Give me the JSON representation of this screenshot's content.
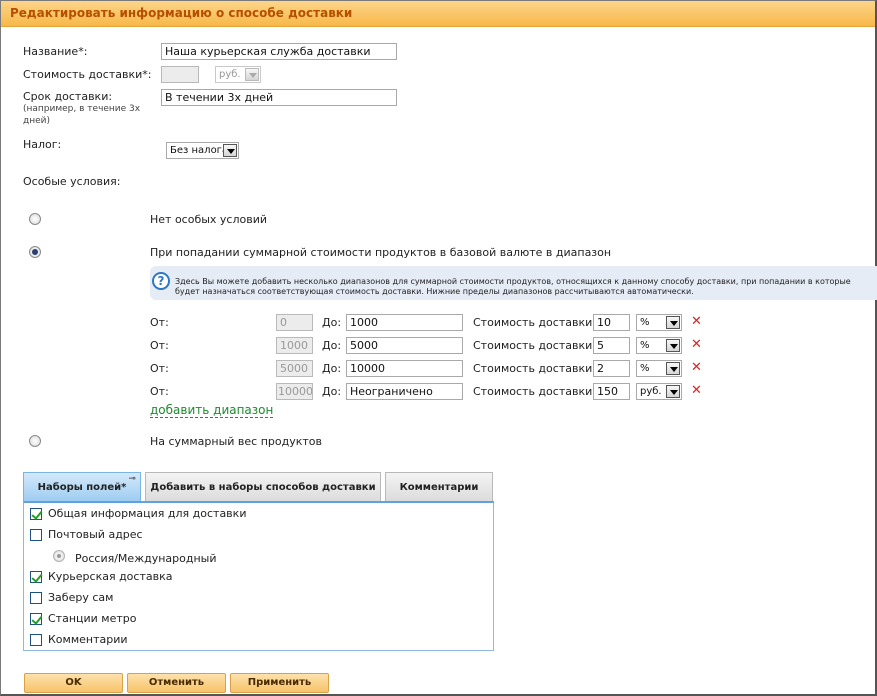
{
  "title": "Редактировать информацию о способе доставки",
  "form": {
    "name_label": "Название*:",
    "name_value": "Наша курьерская служба доставки",
    "cost_label": "Стоимость доставки*:",
    "cost_value": "",
    "cost_currency": "руб.",
    "term_label": "Срок доставки:",
    "term_hint": "(например, в течение 3х дней)",
    "term_value": "В течении 3х дней",
    "tax_label": "Налог:",
    "tax_value": "Без налога",
    "special_label": "Особые условия:"
  },
  "conditions": {
    "none_label": "Нет особых условий",
    "range_label": "При попадании суммарной стоимости продуктов в базовой валюте в диапазон",
    "info_text": "Здесь Вы можете добавить несколько диапазонов для суммарной стоимости продуктов, относящихся к данному способу доставки, при попадании в которые будет назначаться соответствующая стоимость доставки. Нижние пределы диапазонов рассчитываются автоматически.",
    "weight_label": "На суммарный вес продуктов",
    "add_range_label": "добавить диапазон",
    "ranges": [
      {
        "from_label": "От:",
        "from": "0",
        "to_label": "До:",
        "to": "1000",
        "cost_label": "Стоимость доставки:",
        "cost": "10",
        "unit": "%"
      },
      {
        "from_label": "От:",
        "from": "1000",
        "to_label": "До:",
        "to": "5000",
        "cost_label": "Стоимость доставки:",
        "cost": "5",
        "unit": "%"
      },
      {
        "from_label": "От:",
        "from": "5000",
        "to_label": "До:",
        "to": "10000",
        "cost_label": "Стоимость доставки:",
        "cost": "2",
        "unit": "%"
      },
      {
        "from_label": "От:",
        "from": "10000",
        "to_label": "До:",
        "to": "Неограничено",
        "cost_label": "Стоимость доставки:",
        "cost": "150",
        "unit": "руб."
      }
    ],
    "delete_glyph": "✕"
  },
  "tabs": [
    {
      "label": "Наборы полей*"
    },
    {
      "label": "Добавить в наборы способов доставки"
    },
    {
      "label": "Комментарии"
    }
  ],
  "fields": [
    {
      "label": "Общая информация для доставки",
      "checked": true
    },
    {
      "label": "Почтовый адрес",
      "checked": false
    },
    {
      "label": "Россия/Международный"
    },
    {
      "label": "Курьерская доставка",
      "checked": true
    },
    {
      "label": "Заберу сам",
      "checked": false
    },
    {
      "label": "Станции метро",
      "checked": true
    },
    {
      "label": "Комментарии",
      "checked": false
    }
  ],
  "buttons": {
    "ok": "OK",
    "cancel": "Отменить",
    "apply": "Применить"
  },
  "colors": {
    "title_text": "#b64f00",
    "title_bg": "#f7b849",
    "link": "#1f8a2e",
    "delete": "#dd2222",
    "tab_active": "#9ccbf1"
  }
}
